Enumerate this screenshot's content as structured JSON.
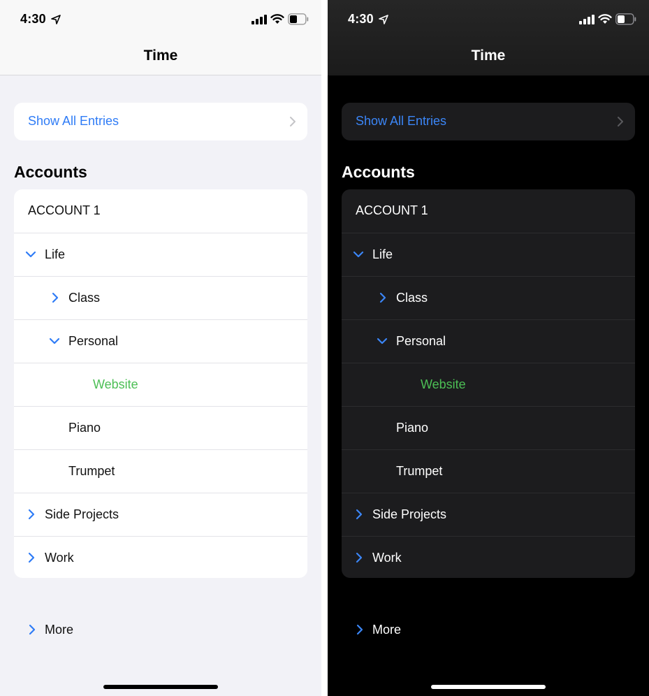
{
  "status_bar": {
    "time": "4:30"
  },
  "nav": {
    "title": "Time"
  },
  "show_all": {
    "label": "Show All Entries"
  },
  "accounts": {
    "header": "Accounts",
    "rows": [
      {
        "label": "ACCOUNT 1",
        "chevron": "none",
        "level": 0
      },
      {
        "label": "Life",
        "chevron": "chevron-down",
        "level": 1
      },
      {
        "label": "Class",
        "chevron": "chevron-right",
        "level": 2
      },
      {
        "label": "Personal",
        "chevron": "chevron-down",
        "level": 2
      },
      {
        "label": "Website",
        "chevron": "none",
        "level": 3,
        "color": "#4cbf55"
      },
      {
        "label": "Piano",
        "chevron": "none",
        "level": 2
      },
      {
        "label": "Trumpet",
        "chevron": "none",
        "level": 2
      },
      {
        "label": "Side Projects",
        "chevron": "chevron-right",
        "level": 1
      },
      {
        "label": "Work",
        "chevron": "chevron-right",
        "level": 1
      }
    ]
  },
  "more": {
    "label": "More"
  },
  "colors": {
    "accent_blue": "#2f7cf6",
    "highlight_green": "#4cbf55",
    "light_background": "#f2f2f7",
    "dark_background": "#000000",
    "dark_card": "#1c1c1e"
  }
}
